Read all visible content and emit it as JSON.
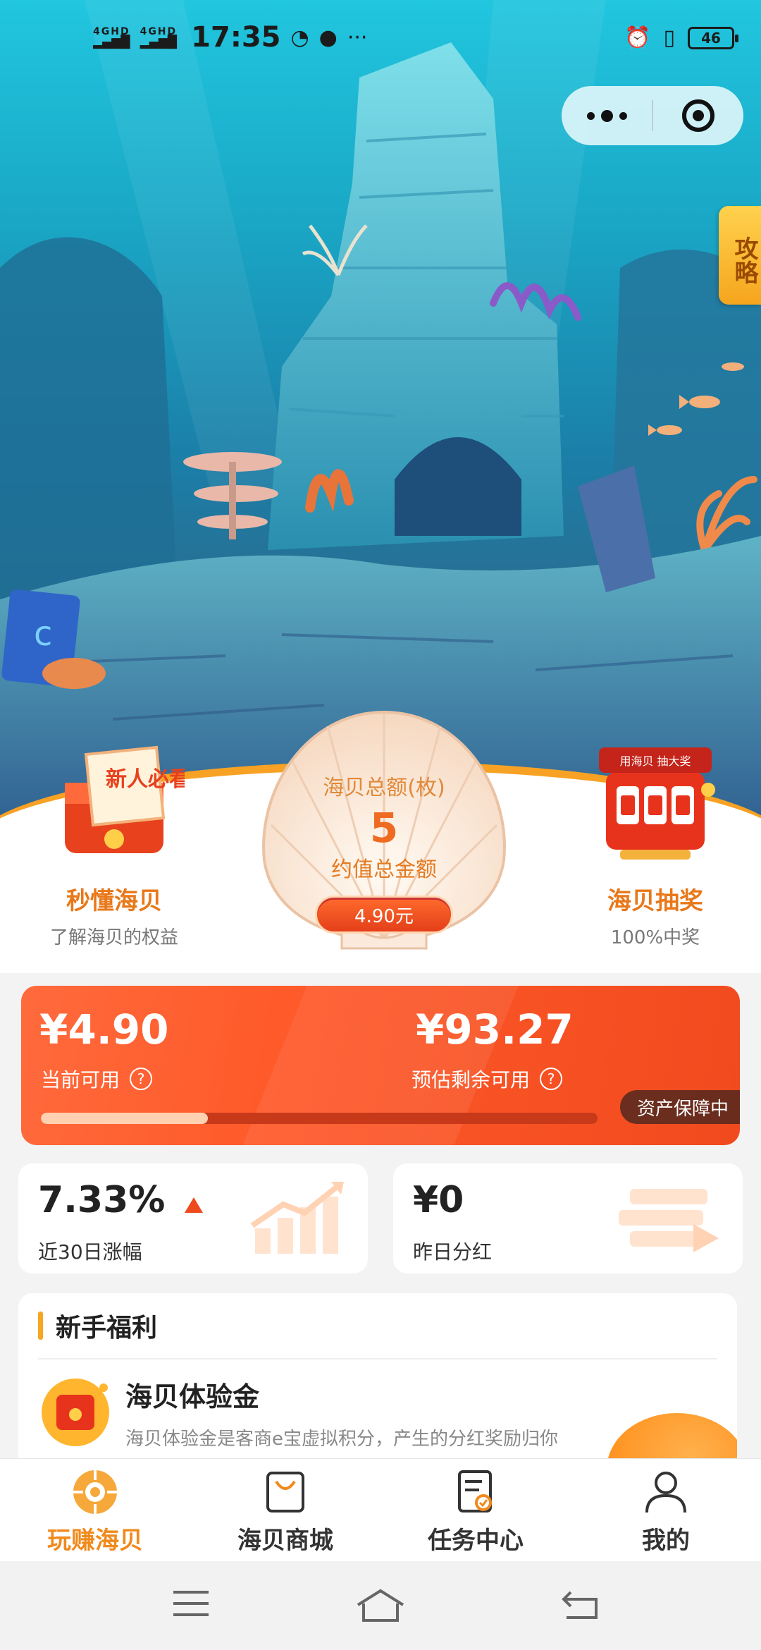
{
  "status_bar": {
    "signal1": "4GHD",
    "signal2": "4GHD",
    "time": "17:35",
    "more": "···",
    "battery": "46"
  },
  "strategy_tab": "攻略",
  "left_feature": {
    "badge": "新人必看",
    "title": "秒懂海贝",
    "subtitle": "了解海贝的权益"
  },
  "right_feature": {
    "banner": "用海贝 抽大奖",
    "title": "海贝抽奖",
    "subtitle": "100%中奖"
  },
  "shell": {
    "label": "海贝总额(枚)",
    "count": "5",
    "sub_label": "约值总金额",
    "value": "4.90元"
  },
  "asset_card": {
    "current_amount": "¥4.90",
    "current_label": "当前可用",
    "remaining_amount": "¥93.27",
    "remaining_label": "预估剩余可用",
    "help_icon": "?",
    "progress": 0.3,
    "protect_label": "资产保障中"
  },
  "stats": {
    "growth_value": "7.33%",
    "growth_label": "近30日涨幅",
    "dividend_value": "¥0",
    "dividend_label": "昨日分红"
  },
  "benefit": {
    "section_title": "新手福利",
    "item_title": "海贝体验金",
    "item_desc": "海贝体验金是客商e宝虚拟积分，产生的分红奖励归你"
  },
  "tabs": [
    {
      "label": "玩赚海贝",
      "active": true
    },
    {
      "label": "海贝商城",
      "active": false
    },
    {
      "label": "任务中心",
      "active": false
    },
    {
      "label": "我的",
      "active": false
    }
  ],
  "colors": {
    "accent": "#f08a1c",
    "card_red": "#f04a1e",
    "shell_text": "#ef6b21"
  }
}
